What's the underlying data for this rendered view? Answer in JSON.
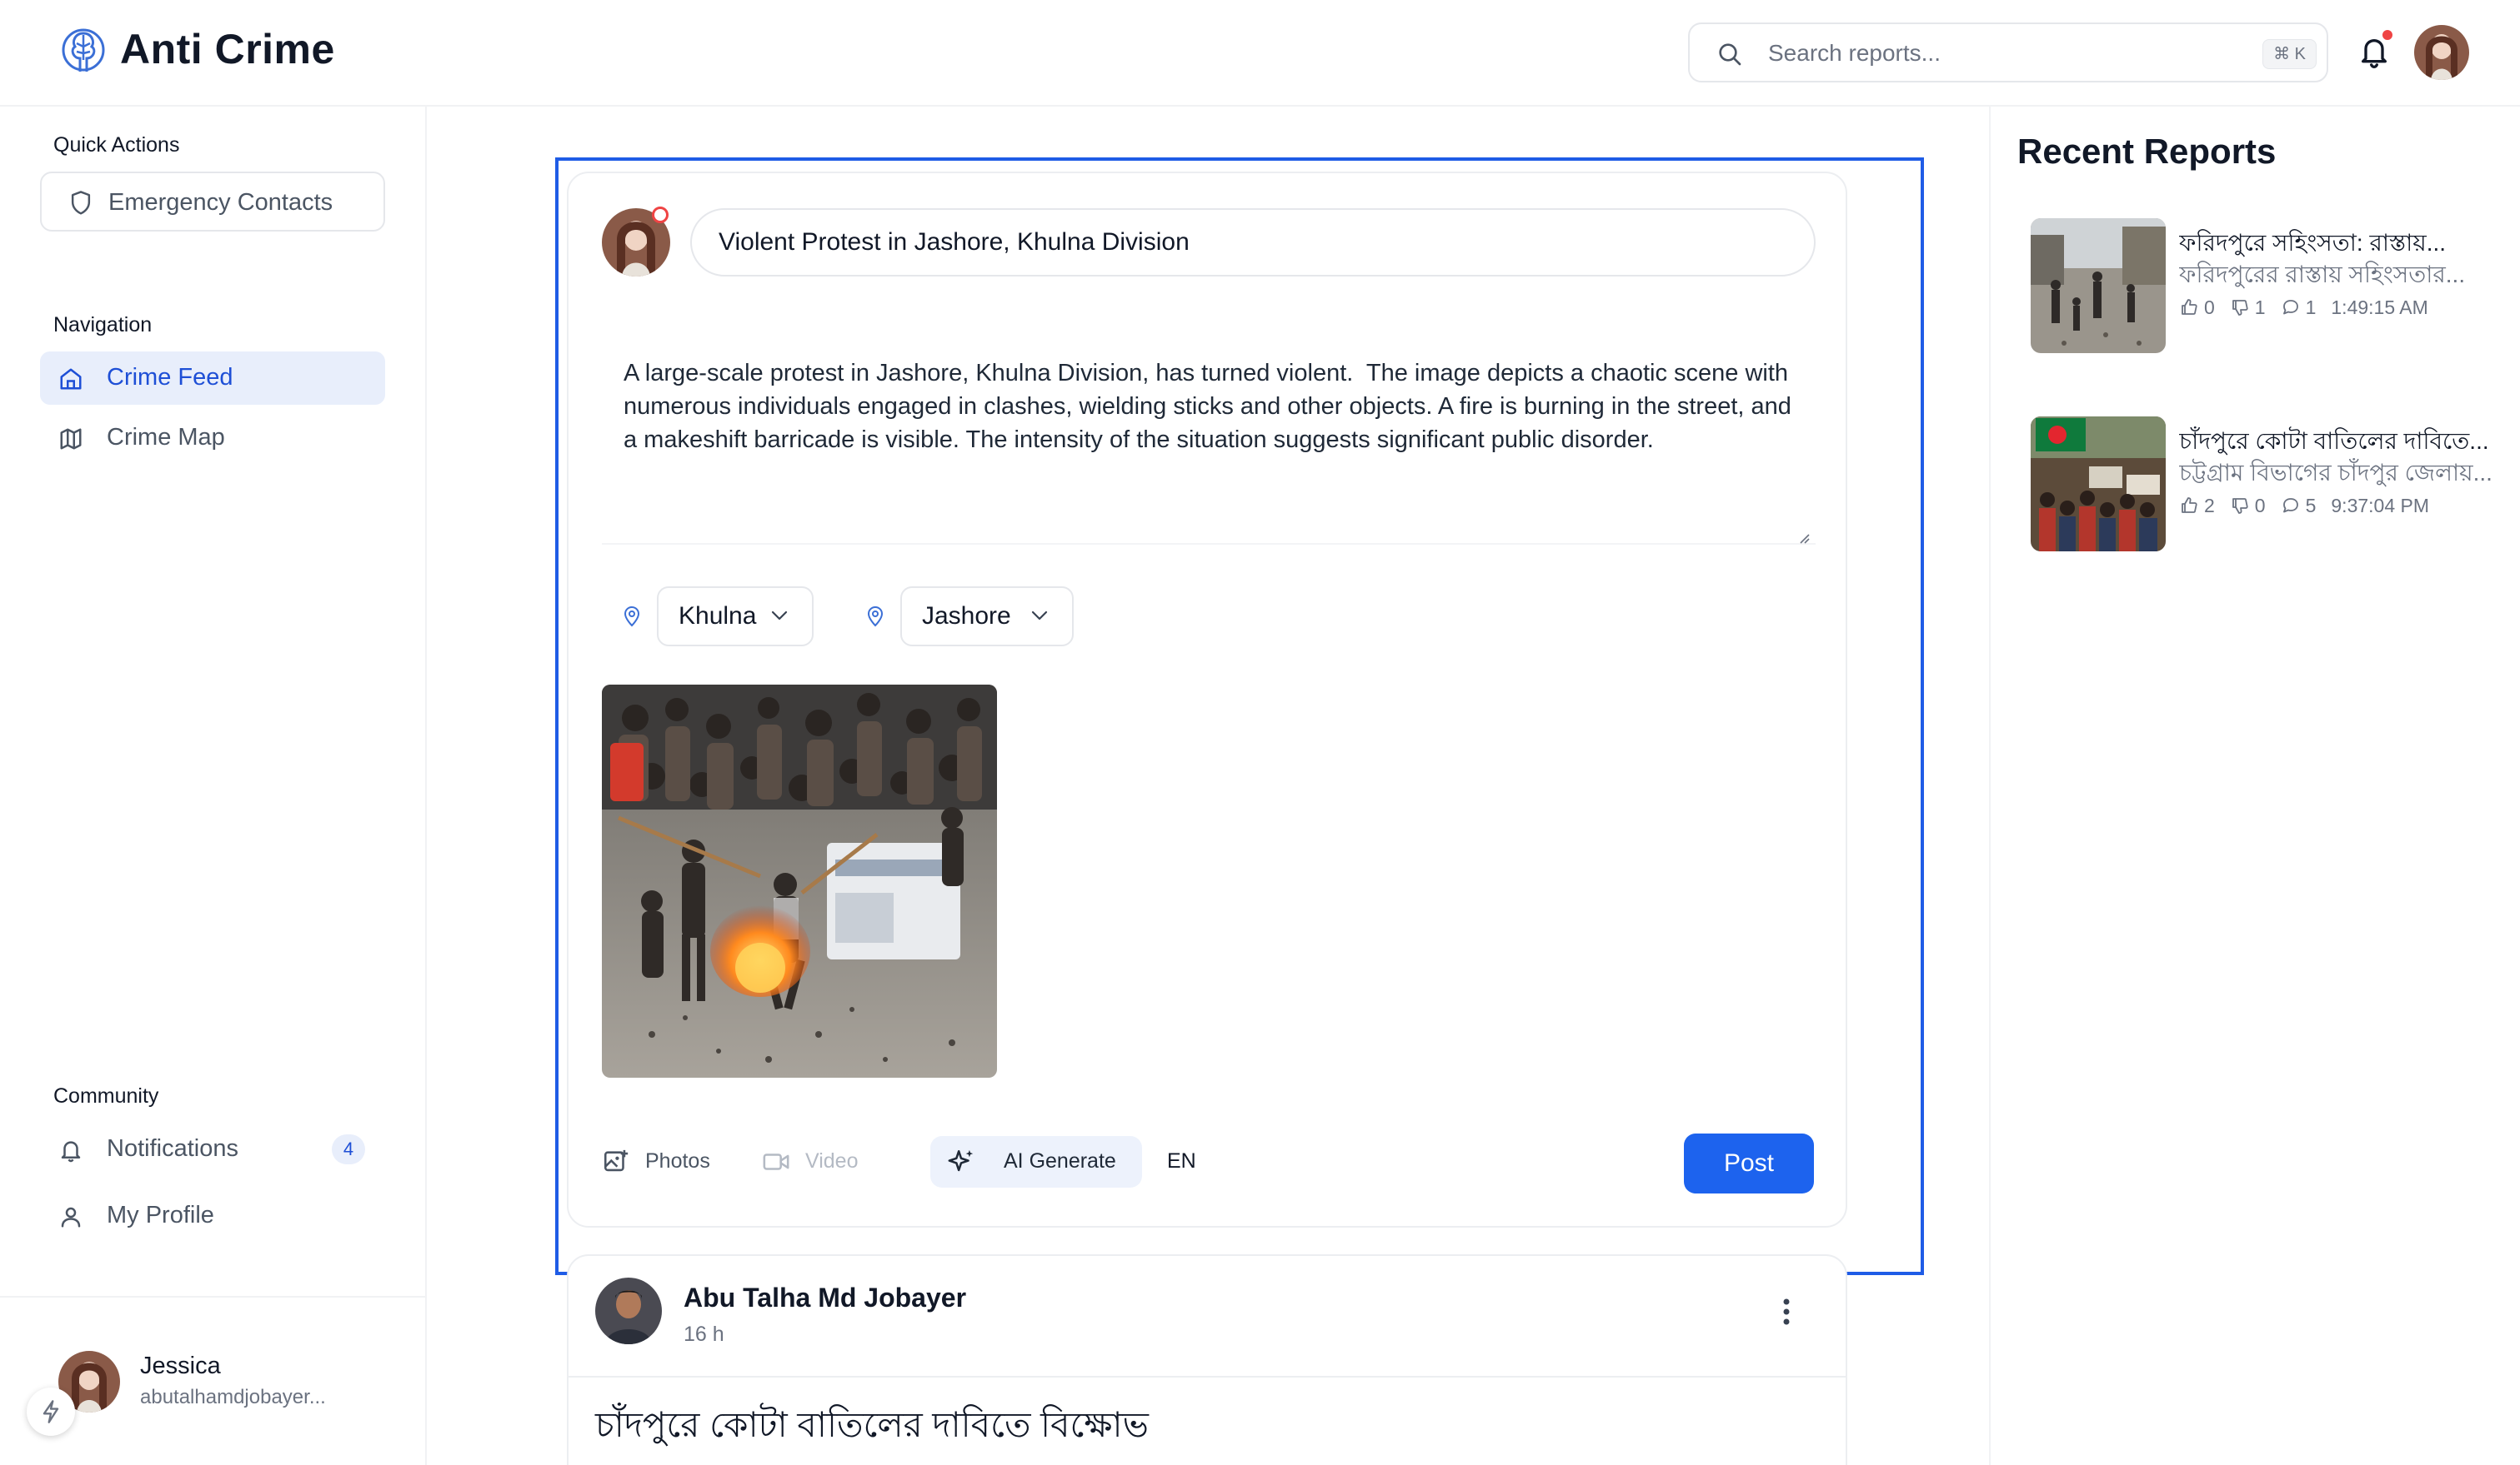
{
  "app": {
    "title": "Anti Crime"
  },
  "search": {
    "placeholder": "Search reports...",
    "shortcut": "⌘ K"
  },
  "sidebar": {
    "quick_actions_label": "Quick Actions",
    "emergency_label": "Emergency Contacts",
    "navigation_label": "Navigation",
    "nav": [
      {
        "label": "Crime Feed",
        "active": true
      },
      {
        "label": "Crime Map",
        "active": false
      }
    ],
    "community_label": "Community",
    "community": [
      {
        "label": "Notifications",
        "badge": "4"
      },
      {
        "label": "My Profile"
      }
    ],
    "user": {
      "name": "Jessica",
      "email": "abutalhamdjobayer..."
    }
  },
  "composer": {
    "title_value": "Violent Protest in Jashore, Khulna Division",
    "description": "A large-scale protest in Jashore, Khulna Division, has turned violent.  The image depicts a chaotic scene with numerous individuals engaged in clashes, wielding sticks and other objects. A fire is burning in the street, and a makeshift barricade is visible. The intensity of the situation suggests significant public disorder.",
    "division": "Khulna",
    "district": "Jashore",
    "tools": {
      "photos": "Photos",
      "video": "Video",
      "ai_generate": "AI Generate",
      "language": "EN"
    },
    "post_label": "Post"
  },
  "feed_post": {
    "author": "Abu Talha Md Jobayer",
    "time": "16 h",
    "title": "চাঁদপুরে কোটা বাতিলের দাবিতে বিক্ষোভ"
  },
  "recent": {
    "title": "Recent Reports",
    "items": [
      {
        "title": "ফরিদপুরে সহিংসতা: রাস্তায়...",
        "subtitle": "ফরিদপুরের রাস্তায় সহিংসতার...",
        "likes": "0",
        "dislikes": "1",
        "comments": "1",
        "time": "1:49:15 AM"
      },
      {
        "title": "চাঁদপুরে কোটা বাতিলের দাবিতে...",
        "subtitle": "চট্টগ্রাম বিভাগের চাঁদপুর জেলায়...",
        "likes": "2",
        "dislikes": "0",
        "comments": "5",
        "time": "9:37:04 PM"
      }
    ]
  },
  "colors": {
    "accent": "#1d63ee",
    "active_bg": "#e8eefb",
    "selection": "#1f5ce6",
    "notification_dot": "#ef4444"
  }
}
